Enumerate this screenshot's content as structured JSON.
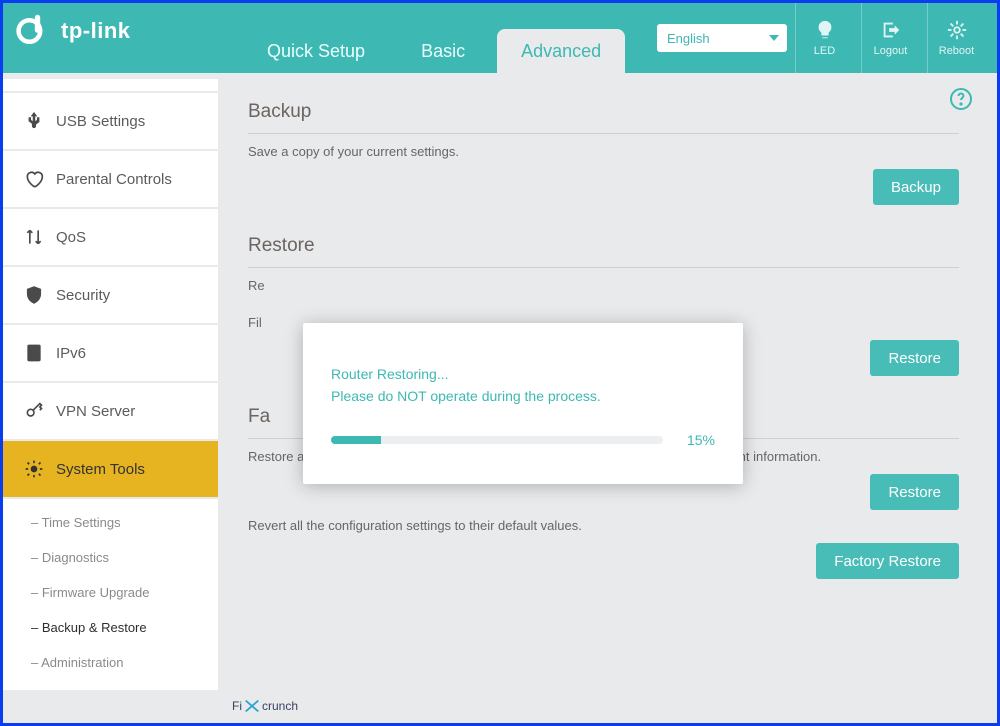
{
  "brand": "tp-link",
  "tabs": {
    "quick": "Quick Setup",
    "basic": "Basic",
    "advanced": "Advanced"
  },
  "header": {
    "language": "English",
    "led": "LED",
    "logout": "Logout",
    "reboot": "Reboot"
  },
  "sidebar": {
    "usb": "USB Settings",
    "parental": "Parental Controls",
    "qos": "QoS",
    "security": "Security",
    "ipv6": "IPv6",
    "vpn": "VPN Server",
    "systools": "System Tools",
    "sub": {
      "time": "Time Settings",
      "diag": "Diagnostics",
      "fw": "Firmware Upgrade",
      "backup": "Backup & Restore",
      "admin": "Administration"
    }
  },
  "sections": {
    "backup": {
      "title": "Backup",
      "text": "Save a copy of your current settings.",
      "btn": "Backup"
    },
    "restore": {
      "title": "Restore",
      "rowRe": "Re",
      "rowFil": "Fil",
      "btn": "Restore"
    },
    "factory": {
      "title": "Fa",
      "text1": "Restore all configuration settings to default values, except your login and cloud account information.",
      "btn1": "Restore",
      "text2": "Revert all the configuration settings to their default values.",
      "btn2": "Factory Restore"
    }
  },
  "modal": {
    "line1": "Router Restoring...",
    "line2": "Please do NOT operate during the process.",
    "pct_label": "15%",
    "pct": 15
  },
  "watermark": {
    "a": "Fi",
    "b": "crunch"
  }
}
